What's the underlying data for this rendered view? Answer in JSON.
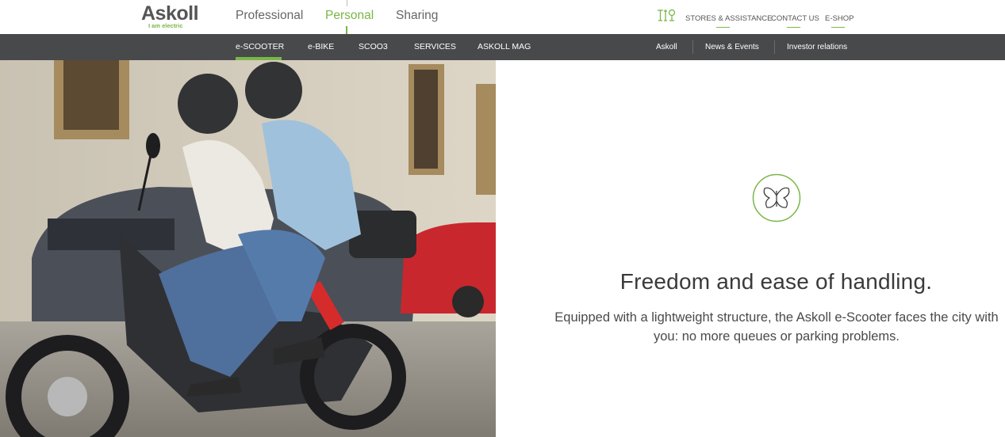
{
  "brand": {
    "name": "Askoll",
    "tagline": "I am electric",
    "accent_color": "#7ab648",
    "nav_bg_color": "#48494b"
  },
  "segments": [
    {
      "label": "Professional",
      "active": false
    },
    {
      "label": "Personal",
      "active": true
    },
    {
      "label": "Sharing",
      "active": false
    }
  ],
  "utility_links": [
    {
      "label": "STORES & ASSISTANCE",
      "icon": "store-locator-icon"
    },
    {
      "label": "CONTACT US"
    },
    {
      "label": "E-SHOP"
    }
  ],
  "main_nav": [
    {
      "label": "e-SCOOTER",
      "active": true
    },
    {
      "label": "e-BIKE",
      "active": false
    },
    {
      "label": "SCOO3",
      "active": false
    },
    {
      "label": "SERVICES",
      "active": false
    },
    {
      "label": "ASKOLL MAG",
      "active": false
    }
  ],
  "corporate_nav": [
    {
      "label": "Askoll"
    },
    {
      "label": "News & Events"
    },
    {
      "label": "Investor relations"
    }
  ],
  "hero": {
    "image_subject": "couple-riding-askoll-escooter"
  },
  "feature": {
    "icon": "butterfly-icon",
    "title": "Freedom and ease of handling.",
    "description": "Equipped with a lightweight structure, the Askoll e-Scooter faces the city with you: no more queues or parking problems."
  }
}
